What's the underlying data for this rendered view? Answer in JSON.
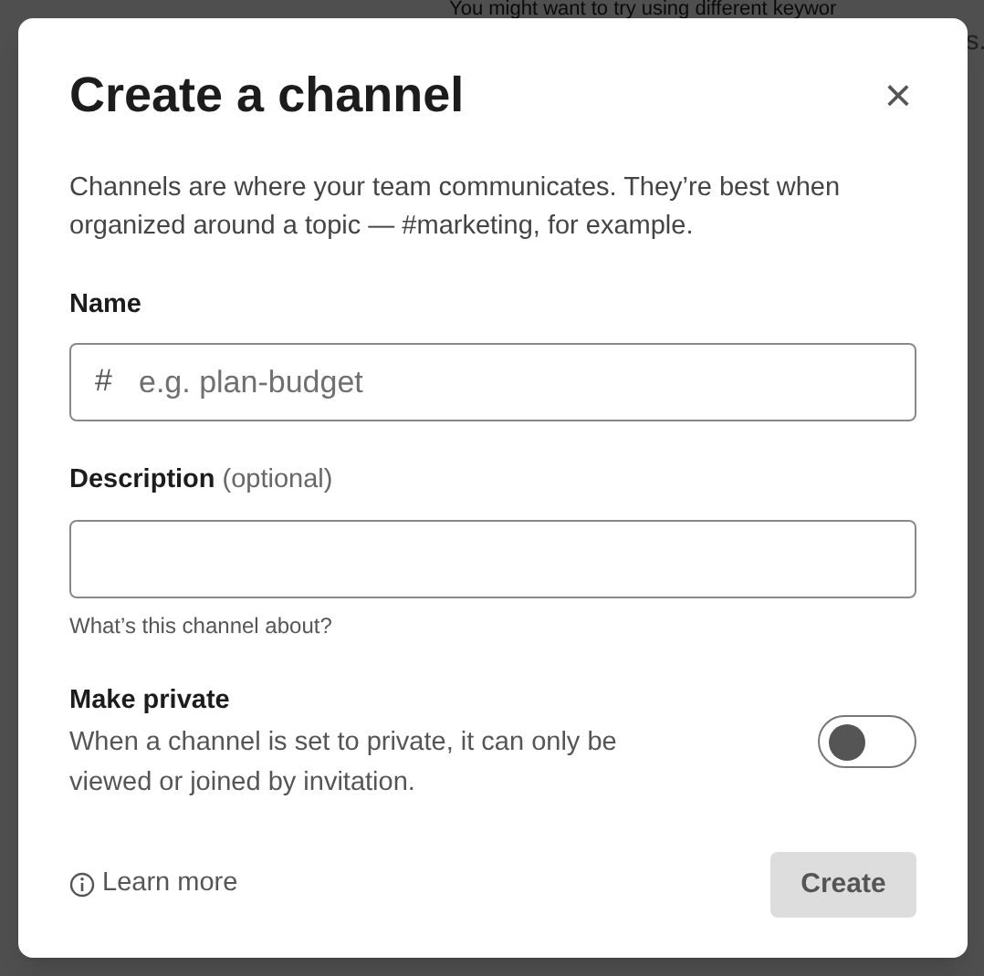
{
  "background": {
    "lines": [
      "You might want to try using different keywor",
      "s."
    ]
  },
  "dialog": {
    "title": "Create a channel",
    "close": "×",
    "intro": "Channels are where your team communicates. They’re best when organized around a topic — #marketing, for example.",
    "fields": [
      {
        "label": "Name",
        "prefix": "#",
        "placeholder": "e.g. plan-budget"
      },
      {
        "label": "Description",
        "optional": "(optional)",
        "hint": "What’s this channel about?"
      }
    ],
    "private": {
      "label": "Make private",
      "text": "When a channel is set to private, it can only be viewed or joined by invitation.",
      "on": false
    },
    "learn_more": "Learn more",
    "create": {
      "label": "Create",
      "disabled": true
    }
  }
}
